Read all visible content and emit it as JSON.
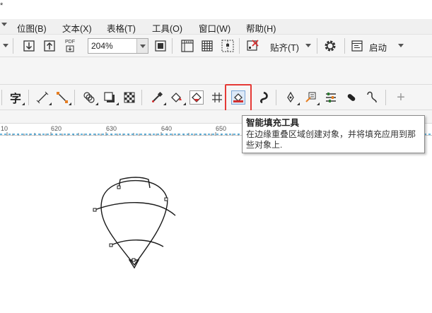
{
  "window": {
    "title": "*"
  },
  "menu": {
    "items": [
      {
        "label": "位图(B)"
      },
      {
        "label": "文本(X)"
      },
      {
        "label": "表格(T)"
      },
      {
        "label": "工具(O)"
      },
      {
        "label": "窗口(W)"
      },
      {
        "label": "帮助(H)"
      }
    ]
  },
  "toolbar": {
    "import_icon": "import-icon",
    "export_icon": "export-icon",
    "pdf_label": "PDF",
    "zoom_value": "204%",
    "snap_label": "贴齐(T)",
    "launch_label": "启动"
  },
  "tools": [
    "text-tool",
    "dimension-tool",
    "connector-tool",
    "blend-tool",
    "drop-shadow-tool",
    "transparency-tool",
    "eyedropper-tool",
    "interactive-fill-tool",
    "smart-fill-tool-alt",
    "mesh-fill-tool",
    "smart-fill-tool",
    "contour-tool",
    "pen-tool",
    "attributes-eyedropper-tool",
    "align-guides-tool",
    "shape-tool",
    "bspline-tool",
    "add-tool"
  ],
  "text_tool_label": "字",
  "ruler": {
    "labels": [
      "10",
      "620",
      "630",
      "640",
      "650"
    ]
  },
  "tooltip": {
    "title": "智能填充工具",
    "description": "在边缘重叠区域创建对象，并将填充应用到那些对象上."
  },
  "colors": {
    "highlight": "#e53935",
    "ruler_accent": "#3aa0d6"
  }
}
